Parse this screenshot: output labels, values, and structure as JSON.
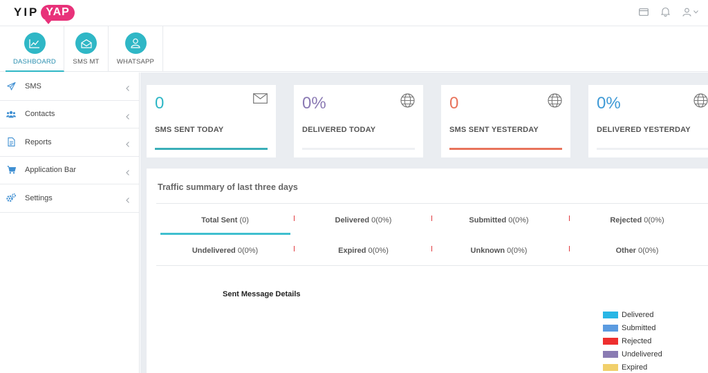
{
  "brand": {
    "part1": "YIP",
    "part2": "YAP"
  },
  "modules": [
    {
      "label": "DASHBOARD",
      "icon": "chart-line-icon",
      "active": true
    },
    {
      "label": "SMS MT",
      "icon": "envelope-open-icon",
      "active": false
    },
    {
      "label": "WHATSAPP",
      "icon": "user-icon",
      "active": false
    }
  ],
  "sidebar": {
    "items": [
      {
        "label": "SMS",
        "icon": "paper-plane-icon"
      },
      {
        "label": "Contacts",
        "icon": "users-icon"
      },
      {
        "label": "Reports",
        "icon": "document-icon"
      },
      {
        "label": "Application Bar",
        "icon": "cart-icon"
      },
      {
        "label": "Settings",
        "icon": "cogs-icon"
      }
    ]
  },
  "cards": [
    {
      "value": "0",
      "caption": "SMS SENT TODAY",
      "icon": "envelope-icon",
      "color": "#2fb7c6",
      "bar_color": "#3aaeb8"
    },
    {
      "value": "0%",
      "caption": "DELIVERED TODAY",
      "icon": "globe-icon",
      "color": "#8a79b3",
      "bar_color": "#eef0f3"
    },
    {
      "value": "0",
      "caption": "SMS SENT YESTERDAY",
      "icon": "globe-icon",
      "color": "#e8735b",
      "bar_color": "#e8735b"
    },
    {
      "value": "0%",
      "caption": "DELIVERED YESTERDAY",
      "icon": "globe-icon",
      "color": "#3f9ad6",
      "bar_color": "#eef0f3"
    }
  ],
  "traffic": {
    "title": "Traffic summary of last three days",
    "stats": [
      {
        "label": "Total Sent",
        "value": "(0)"
      },
      {
        "label": "Delivered",
        "value": "0(0%)"
      },
      {
        "label": "Submitted",
        "value": "0(0%)"
      },
      {
        "label": "Rejected",
        "value": "0(0%)"
      },
      {
        "label": "Undelivered",
        "value": "0(0%)"
      },
      {
        "label": "Expired",
        "value": "0(0%)"
      },
      {
        "label": "Unknown",
        "value": "0(0%)"
      },
      {
        "label": "Other",
        "value": "0(0%)"
      }
    ]
  },
  "chart": {
    "title": "Sent Message Details",
    "legend": [
      {
        "label": "Delivered",
        "color": "#29b6e5"
      },
      {
        "label": "Submitted",
        "color": "#5b9be0"
      },
      {
        "label": "Rejected",
        "color": "#ee2f2f"
      },
      {
        "label": "Undelivered",
        "color": "#8a7bb3"
      },
      {
        "label": "Expired",
        "color": "#f1d06b"
      }
    ]
  }
}
